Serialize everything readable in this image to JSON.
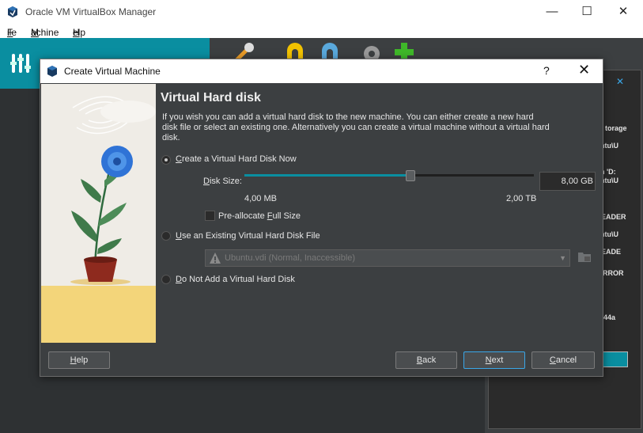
{
  "window": {
    "title": "Oracle VM VirtualBox Manager",
    "minimize": "—",
    "maximize": "☐",
    "close": "✕"
  },
  "menu": [
    {
      "key": "F",
      "rest": "ile"
    },
    {
      "key": "M",
      "rest": "achine"
    },
    {
      "key": "H",
      "rest": "elp"
    }
  ],
  "right_panel_text": [
    "torage",
    "ntu\\U",
    "n 'D:",
    "ntu\\U",
    "EADER",
    "ntu\\U",
    "EADE",
    "RROR",
    "-44a"
  ],
  "dialog": {
    "title": "Create Virtual Machine",
    "help_glyph": "?",
    "close_glyph": "✕",
    "heading": "Virtual Hard disk",
    "description": "If you wish you can add a virtual hard disk to the new machine. You can either create a new hard disk file or select an existing one. Alternatively you can create a virtual machine without a virtual hard disk.",
    "option_create": {
      "pre": "",
      "key": "C",
      "rest": "reate a Virtual Hard Disk Now"
    },
    "disk_size_label": {
      "pre": "",
      "key": "D",
      "rest": "isk Size:"
    },
    "disk_size_value": "8,00 GB",
    "slider_fraction": 0.57,
    "slider_min": "4,00 MB",
    "slider_max": "2,00 TB",
    "preallocate": {
      "pre": "Pre-allocate ",
      "key": "F",
      "rest": "ull Size"
    },
    "option_existing": {
      "pre": "",
      "key": "U",
      "rest": "se an Existing Virtual Hard Disk File"
    },
    "existing_value": "Ubuntu.vdi (Normal, Inaccessible)",
    "option_none": {
      "pre": "",
      "key": "D",
      "rest": "o Not Add a Virtual Hard Disk"
    },
    "buttons": {
      "help": {
        "pre": "",
        "key": "H",
        "rest": "elp"
      },
      "back": {
        "pre": "",
        "key": "B",
        "rest": "ack"
      },
      "next": {
        "pre": "",
        "key": "N",
        "rest": "ext"
      },
      "cancel": {
        "pre": "",
        "key": "C",
        "rest": "ancel"
      }
    }
  },
  "colors": {
    "accent": "#0a8ea0",
    "dialog_bg": "#3c3f41",
    "art_wall": "#efece6",
    "art_floor": "#f3d57a"
  }
}
